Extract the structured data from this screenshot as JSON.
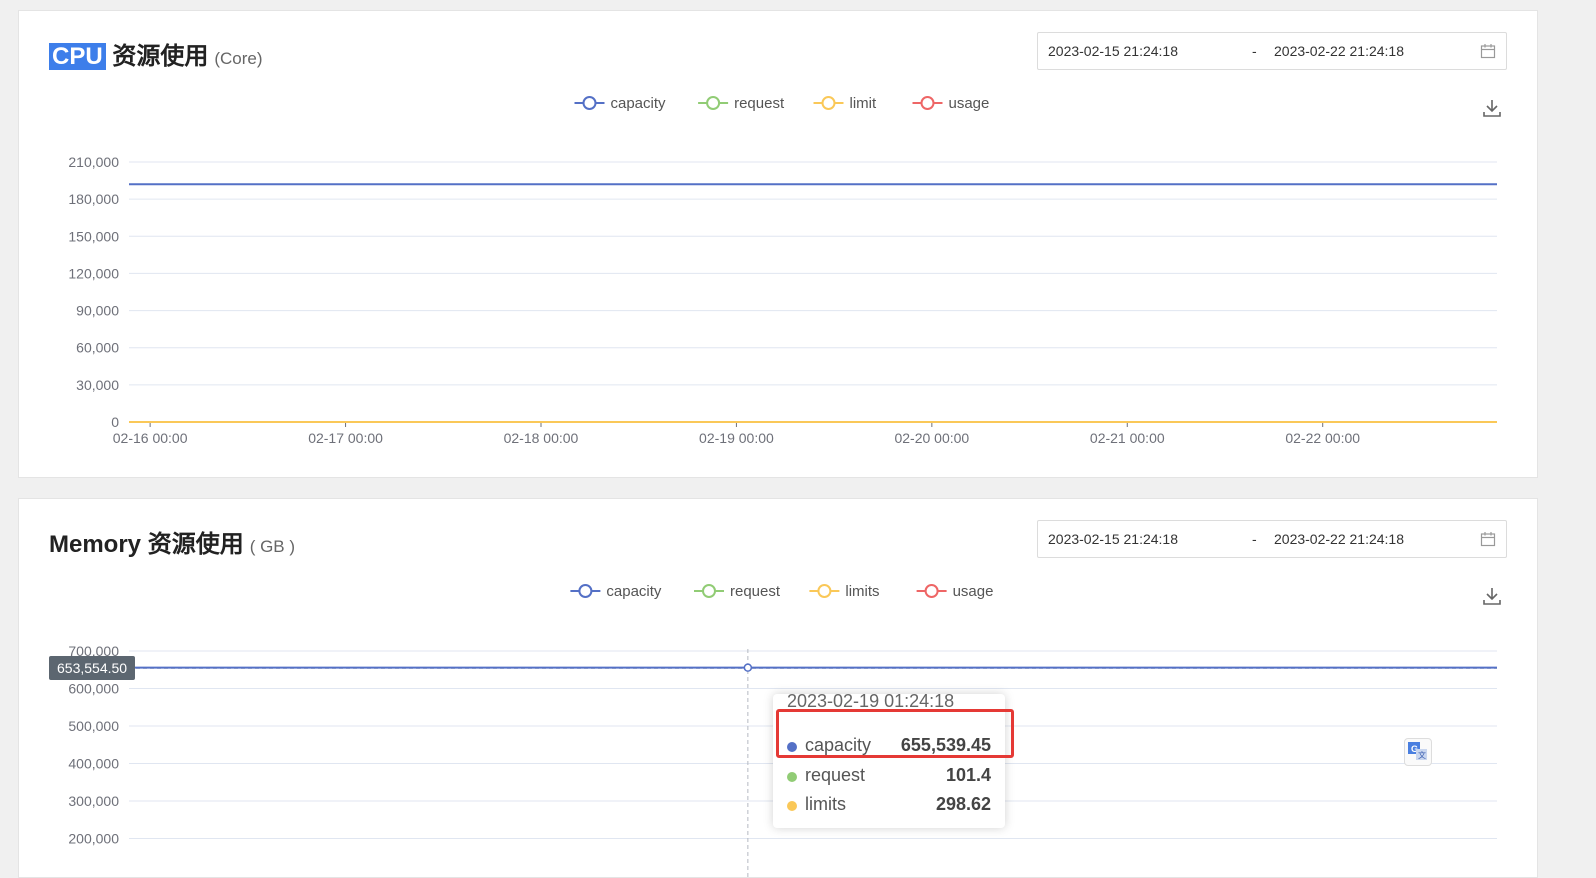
{
  "cpu": {
    "title_highlight": "CPU",
    "title_rest": " 资源使用",
    "unit": "(Core)",
    "date_start": "2023-02-15 21:24:18",
    "date_sep": "-",
    "date_end": "2023-02-22 21:24:18"
  },
  "memory": {
    "title": "Memory 资源使用",
    "unit": "( GB )",
    "date_start": "2023-02-15 21:24:18",
    "date_sep": "-",
    "date_end": "2023-02-22 21:24:18",
    "axis_pointer_value": "653,554.50",
    "tooltip": {
      "time": "2023-02-19 01:24:18",
      "rows": [
        {
          "name": "capacity",
          "value": "655,539.45"
        },
        {
          "name": "request",
          "value": "101.4"
        },
        {
          "name": "limits",
          "value": "298.62"
        }
      ]
    }
  },
  "colors": {
    "capacity": "#5470c6",
    "request": "#91cc75",
    "limit": "#fac858",
    "usage": "#ee6666"
  },
  "chart_data": [
    {
      "type": "line",
      "title": "CPU 资源使用",
      "unit": "(Core)",
      "legend": [
        "capacity",
        "request",
        "limit",
        "usage"
      ],
      "legend_position": "top-center",
      "x_ticks": [
        "02-16 00:00",
        "02-17 00:00",
        "02-18 00:00",
        "02-19 00:00",
        "02-20 00:00",
        "02-21 00:00",
        "02-22 00:00"
      ],
      "x_range": [
        "2023-02-15 21:24:18",
        "2023-02-22 21:24:18"
      ],
      "y_ticks": [
        "0",
        "30,000",
        "60,000",
        "90,000",
        "120,000",
        "150,000",
        "180,000",
        "210,000"
      ],
      "ylim": [
        0,
        210000
      ],
      "grid": true,
      "series": [
        {
          "name": "capacity",
          "x": [
            "2023-02-15 21:24:18",
            "2023-02-22 21:24:18"
          ],
          "values": [
            192000,
            192000
          ]
        },
        {
          "name": "request",
          "x": [
            "2023-02-15 21:24:18",
            "2023-02-22 21:24:18"
          ],
          "values": [
            0,
            0
          ]
        },
        {
          "name": "limit",
          "x": [
            "2023-02-15 21:24:18",
            "2023-02-22 21:24:18"
          ],
          "values": [
            0,
            0
          ]
        },
        {
          "name": "usage",
          "x": [
            "2023-02-15 21:24:18",
            "2023-02-22 21:24:18"
          ],
          "values": [
            0,
            0
          ]
        }
      ]
    },
    {
      "type": "line",
      "title": "Memory 资源使用",
      "unit": "( GB )",
      "legend": [
        "capacity",
        "request",
        "limits",
        "usage"
      ],
      "legend_position": "top-center",
      "y_ticks": [
        "200,000",
        "300,000",
        "400,000",
        "500,000",
        "600,000",
        "700,000"
      ],
      "ylim": [
        0,
        700000
      ],
      "grid": true,
      "series": [
        {
          "name": "capacity",
          "x": [
            "2023-02-15 21:24:18",
            "2023-02-19 01:24:18",
            "2023-02-22 21:24:18"
          ],
          "values": [
            655539.45,
            655539.45,
            655539.45
          ]
        },
        {
          "name": "request",
          "x": [
            "2023-02-19 01:24:18"
          ],
          "values": [
            101.4
          ]
        },
        {
          "name": "limits",
          "x": [
            "2023-02-19 01:24:18"
          ],
          "values": [
            298.62
          ]
        }
      ]
    }
  ]
}
